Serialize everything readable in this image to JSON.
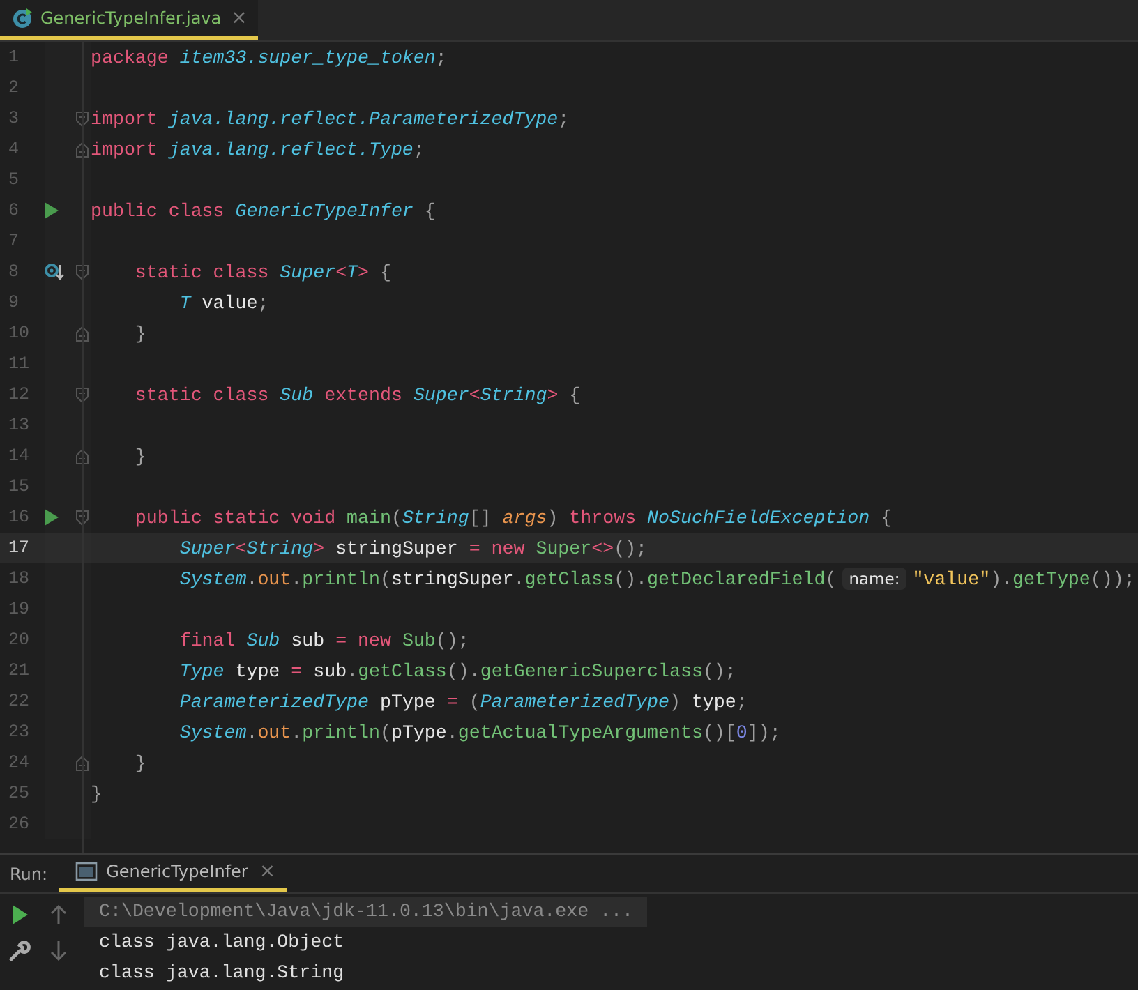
{
  "editor_tab": {
    "label": "GenericTypeInfer.java",
    "selected": true,
    "close": "×"
  },
  "lines": [
    {
      "number": "1",
      "current": false,
      "run_marker": false,
      "override_marker": false,
      "fold_start": false,
      "fold_end": false,
      "tokens": [
        {
          "kind": "keyword",
          "text": "package "
        },
        {
          "kind": "type",
          "text": "item33.super_type_token"
        },
        {
          "kind": "punct",
          "text": ";"
        }
      ]
    },
    {
      "number": "2",
      "current": false,
      "run_marker": false,
      "override_marker": false,
      "fold_start": false,
      "fold_end": false
    },
    {
      "number": "3",
      "current": false,
      "run_marker": false,
      "override_marker": false,
      "fold_start": true,
      "fold_end": false,
      "tokens": [
        {
          "kind": "keyword",
          "text": "import "
        },
        {
          "kind": "type",
          "text": "java.lang.reflect.ParameterizedType"
        },
        {
          "kind": "punct",
          "text": ";"
        }
      ]
    },
    {
      "number": "4",
      "current": false,
      "run_marker": false,
      "override_marker": false,
      "fold_start": false,
      "fold_end": true,
      "tokens": [
        {
          "kind": "keyword",
          "text": "import "
        },
        {
          "kind": "type",
          "text": "java.lang.reflect.Type"
        },
        {
          "kind": "punct",
          "text": ";"
        }
      ]
    },
    {
      "number": "5",
      "current": false,
      "run_marker": false,
      "override_marker": false,
      "fold_start": false,
      "fold_end": false
    },
    {
      "number": "6",
      "current": false,
      "run_marker": true,
      "override_marker": false,
      "fold_start": false,
      "fold_end": false,
      "tokens": [
        {
          "kind": "keyword",
          "text": "public class "
        },
        {
          "kind": "type",
          "text": "GenericTypeInfer"
        },
        {
          "kind": "punct",
          "text": " {"
        }
      ]
    },
    {
      "number": "7",
      "current": false,
      "run_marker": false,
      "override_marker": false,
      "fold_start": false,
      "fold_end": false
    },
    {
      "number": "8",
      "current": false,
      "run_marker": false,
      "override_marker": true,
      "fold_start": true,
      "fold_end": false,
      "tokens": [
        {
          "kind": "keyword",
          "text": "    static class "
        },
        {
          "kind": "type",
          "text": "Super"
        },
        {
          "kind": "keyword",
          "text": "<"
        },
        {
          "kind": "type",
          "text": "T"
        },
        {
          "kind": "keyword",
          "text": ">"
        },
        {
          "kind": "punct",
          "text": " {"
        }
      ]
    },
    {
      "number": "9",
      "current": false,
      "run_marker": false,
      "override_marker": false,
      "fold_start": false,
      "fold_end": false,
      "tokens": [
        {
          "kind": "type",
          "text": "        T"
        },
        {
          "kind": "plain",
          "text": " value"
        },
        {
          "kind": "punct",
          "text": ";"
        }
      ]
    },
    {
      "number": "10",
      "current": false,
      "run_marker": false,
      "override_marker": false,
      "fold_start": false,
      "fold_end": true,
      "tokens": [
        {
          "kind": "punct",
          "text": "    }"
        }
      ]
    },
    {
      "number": "11",
      "current": false,
      "run_marker": false,
      "override_marker": false,
      "fold_start": false,
      "fold_end": false
    },
    {
      "number": "12",
      "current": false,
      "run_marker": false,
      "override_marker": false,
      "fold_start": true,
      "fold_end": false,
      "tokens": [
        {
          "kind": "keyword",
          "text": "    static class "
        },
        {
          "kind": "type",
          "text": "Sub"
        },
        {
          "kind": "keyword",
          "text": " extends "
        },
        {
          "kind": "type",
          "text": "Super"
        },
        {
          "kind": "keyword",
          "text": "<"
        },
        {
          "kind": "type",
          "text": "String"
        },
        {
          "kind": "keyword",
          "text": ">"
        },
        {
          "kind": "punct",
          "text": " {"
        }
      ]
    },
    {
      "number": "13",
      "current": false,
      "run_marker": false,
      "override_marker": false,
      "fold_start": false,
      "fold_end": false
    },
    {
      "number": "14",
      "current": false,
      "run_marker": false,
      "override_marker": false,
      "fold_start": false,
      "fold_end": true,
      "tokens": [
        {
          "kind": "punct",
          "text": "    }"
        }
      ]
    },
    {
      "number": "15",
      "current": false,
      "run_marker": false,
      "override_marker": false,
      "fold_start": false,
      "fold_end": false
    },
    {
      "number": "16",
      "current": false,
      "run_marker": true,
      "override_marker": false,
      "fold_start": true,
      "fold_end": false,
      "tokens": [
        {
          "kind": "keyword",
          "text": "    public static void "
        },
        {
          "kind": "method",
          "text": "main"
        },
        {
          "kind": "punct",
          "text": "("
        },
        {
          "kind": "type",
          "text": "String"
        },
        {
          "kind": "punct",
          "text": "[] "
        },
        {
          "kind": "param",
          "text": "args"
        },
        {
          "kind": "punct",
          "text": ") "
        },
        {
          "kind": "keyword",
          "text": "throws "
        },
        {
          "kind": "type",
          "text": "NoSuchFieldException"
        },
        {
          "kind": "punct",
          "text": " {"
        }
      ]
    },
    {
      "number": "17",
      "current": true,
      "run_marker": false,
      "override_marker": false,
      "fold_start": false,
      "fold_end": false,
      "tokens": [
        {
          "kind": "type",
          "text": "        Super"
        },
        {
          "kind": "keyword",
          "text": "<"
        },
        {
          "kind": "type",
          "text": "String"
        },
        {
          "kind": "keyword",
          "text": ">"
        },
        {
          "kind": "plain",
          "text": " stringSuper "
        },
        {
          "kind": "keyword",
          "text": "= new "
        },
        {
          "kind": "method",
          "text": "Super"
        },
        {
          "kind": "keyword",
          "text": "<>"
        },
        {
          "kind": "punct",
          "text": "();"
        }
      ]
    },
    {
      "number": "18",
      "current": false,
      "run_marker": false,
      "override_marker": false,
      "fold_start": false,
      "fold_end": false,
      "tokens": [
        {
          "kind": "type",
          "text": "        System"
        },
        {
          "kind": "punct",
          "text": "."
        },
        {
          "kind": "field",
          "text": "out"
        },
        {
          "kind": "punct",
          "text": "."
        },
        {
          "kind": "method",
          "text": "println"
        },
        {
          "kind": "punct",
          "text": "("
        },
        {
          "kind": "plain",
          "text": "stringSuper"
        },
        {
          "kind": "punct",
          "text": "."
        },
        {
          "kind": "method",
          "text": "getClass"
        },
        {
          "kind": "punct",
          "text": "()."
        },
        {
          "kind": "method",
          "text": "getDeclaredField"
        },
        {
          "kind": "punct",
          "text": "("
        },
        {
          "kind": "hint",
          "text": "name:"
        },
        {
          "kind": "string",
          "text": "\"value\""
        },
        {
          "kind": "punct",
          "text": ")."
        },
        {
          "kind": "method",
          "text": "getType"
        },
        {
          "kind": "punct",
          "text": "());"
        }
      ]
    },
    {
      "number": "19",
      "current": false,
      "run_marker": false,
      "override_marker": false,
      "fold_start": false,
      "fold_end": false
    },
    {
      "number": "20",
      "current": false,
      "run_marker": false,
      "override_marker": false,
      "fold_start": false,
      "fold_end": false,
      "tokens": [
        {
          "kind": "keyword",
          "text": "        final "
        },
        {
          "kind": "type",
          "text": "Sub"
        },
        {
          "kind": "plain",
          "text": " sub "
        },
        {
          "kind": "keyword",
          "text": "= new "
        },
        {
          "kind": "method",
          "text": "Sub"
        },
        {
          "kind": "punct",
          "text": "();"
        }
      ]
    },
    {
      "number": "21",
      "current": false,
      "run_marker": false,
      "override_marker": false,
      "fold_start": false,
      "fold_end": false,
      "tokens": [
        {
          "kind": "type",
          "text": "        Type"
        },
        {
          "kind": "plain",
          "text": " type "
        },
        {
          "kind": "keyword",
          "text": "= "
        },
        {
          "kind": "plain",
          "text": "sub"
        },
        {
          "kind": "punct",
          "text": "."
        },
        {
          "kind": "method",
          "text": "getClass"
        },
        {
          "kind": "punct",
          "text": "()."
        },
        {
          "kind": "method",
          "text": "getGenericSuperclass"
        },
        {
          "kind": "punct",
          "text": "();"
        }
      ]
    },
    {
      "number": "22",
      "current": false,
      "run_marker": false,
      "override_marker": false,
      "fold_start": false,
      "fold_end": false,
      "tokens": [
        {
          "kind": "type",
          "text": "        ParameterizedType"
        },
        {
          "kind": "plain",
          "text": " pType "
        },
        {
          "kind": "keyword",
          "text": "= "
        },
        {
          "kind": "punct",
          "text": "("
        },
        {
          "kind": "type",
          "text": "ParameterizedType"
        },
        {
          "kind": "punct",
          "text": ") "
        },
        {
          "kind": "plain",
          "text": "type"
        },
        {
          "kind": "punct",
          "text": ";"
        }
      ]
    },
    {
      "number": "23",
      "current": false,
      "run_marker": false,
      "override_marker": false,
      "fold_start": false,
      "fold_end": false,
      "tokens": [
        {
          "kind": "type",
          "text": "        System"
        },
        {
          "kind": "punct",
          "text": "."
        },
        {
          "kind": "field",
          "text": "out"
        },
        {
          "kind": "punct",
          "text": "."
        },
        {
          "kind": "method",
          "text": "println"
        },
        {
          "kind": "punct",
          "text": "("
        },
        {
          "kind": "plain",
          "text": "pType"
        },
        {
          "kind": "punct",
          "text": "."
        },
        {
          "kind": "method",
          "text": "getActualTypeArguments"
        },
        {
          "kind": "punct",
          "text": "()["
        },
        {
          "kind": "number",
          "text": "0"
        },
        {
          "kind": "punct",
          "text": "]);"
        }
      ]
    },
    {
      "number": "24",
      "current": false,
      "run_marker": false,
      "override_marker": false,
      "fold_start": false,
      "fold_end": true,
      "tokens": [
        {
          "kind": "punct",
          "text": "    }"
        }
      ]
    },
    {
      "number": "25",
      "current": false,
      "run_marker": false,
      "override_marker": false,
      "fold_start": false,
      "fold_end": false,
      "tokens": [
        {
          "kind": "punct",
          "text": "}"
        }
      ]
    },
    {
      "number": "26",
      "current": false,
      "run_marker": false,
      "override_marker": false,
      "fold_start": false,
      "fold_end": false
    }
  ],
  "run_panel": {
    "label": "Run:",
    "tab": {
      "label": "GenericTypeInfer",
      "selected": true,
      "close": "×"
    },
    "console": [
      {
        "kind": "command",
        "text": "C:\\Development\\Java\\jdk-11.0.13\\bin\\java.exe ..."
      },
      {
        "kind": "output",
        "text": "class java.lang.Object"
      },
      {
        "kind": "output",
        "text": "class java.lang.String"
      }
    ]
  }
}
